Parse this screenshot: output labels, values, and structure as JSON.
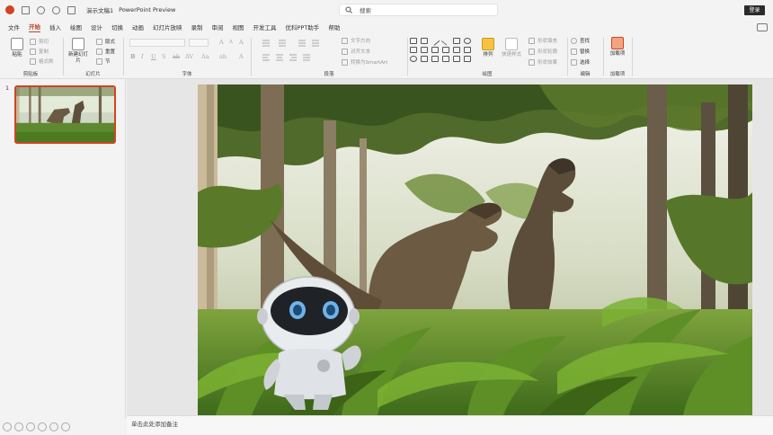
{
  "titlebar": {
    "doc_name": "演示文稿1",
    "app_name": "PowerPoint Preview",
    "search_placeholder": "搜索",
    "login_label": "登录",
    "icons": [
      "powerpoint-logo-icon",
      "save-icon",
      "undo-icon",
      "redo-icon",
      "customize-icon"
    ]
  },
  "tabs": [
    "文件",
    "开始",
    "插入",
    "绘图",
    "设计",
    "切换",
    "动画",
    "幻灯片放映",
    "录制",
    "审阅",
    "视图",
    "开发工具",
    "优科PPT助手",
    "帮助"
  ],
  "active_tab": "开始",
  "ribbon": {
    "clipboard": {
      "label": "剪贴板",
      "paste": "粘贴",
      "cut": "剪切",
      "copy": "复制",
      "format_painter": "格式刷"
    },
    "slides": {
      "label": "幻灯片",
      "new_slide": "新建幻灯片",
      "layout": "版式",
      "reset": "重置",
      "section": "节"
    },
    "font": {
      "label": "字体"
    },
    "paragraph": {
      "label": "段落"
    },
    "drawing": {
      "label": "绘图",
      "arrange": "排列",
      "quick_styles": "快速样式",
      "shape_fill": "形状填充",
      "shape_outline": "形状轮廓",
      "shape_effects": "形状效果"
    },
    "editing": {
      "label": "编辑",
      "find": "查找",
      "replace": "替换",
      "select": "选择"
    },
    "addins": {
      "label": "加载项",
      "addin_button": "加载项"
    },
    "text_direction": "文字方向",
    "align_text": "对齐文本",
    "convert_smartart": "转换为SmartArt"
  },
  "slides_panel": {
    "slide_number": "1"
  },
  "notes_placeholder": "单击此处添加备注",
  "colors": {
    "accent": "#d04423",
    "active_tab": "#b7472a"
  }
}
